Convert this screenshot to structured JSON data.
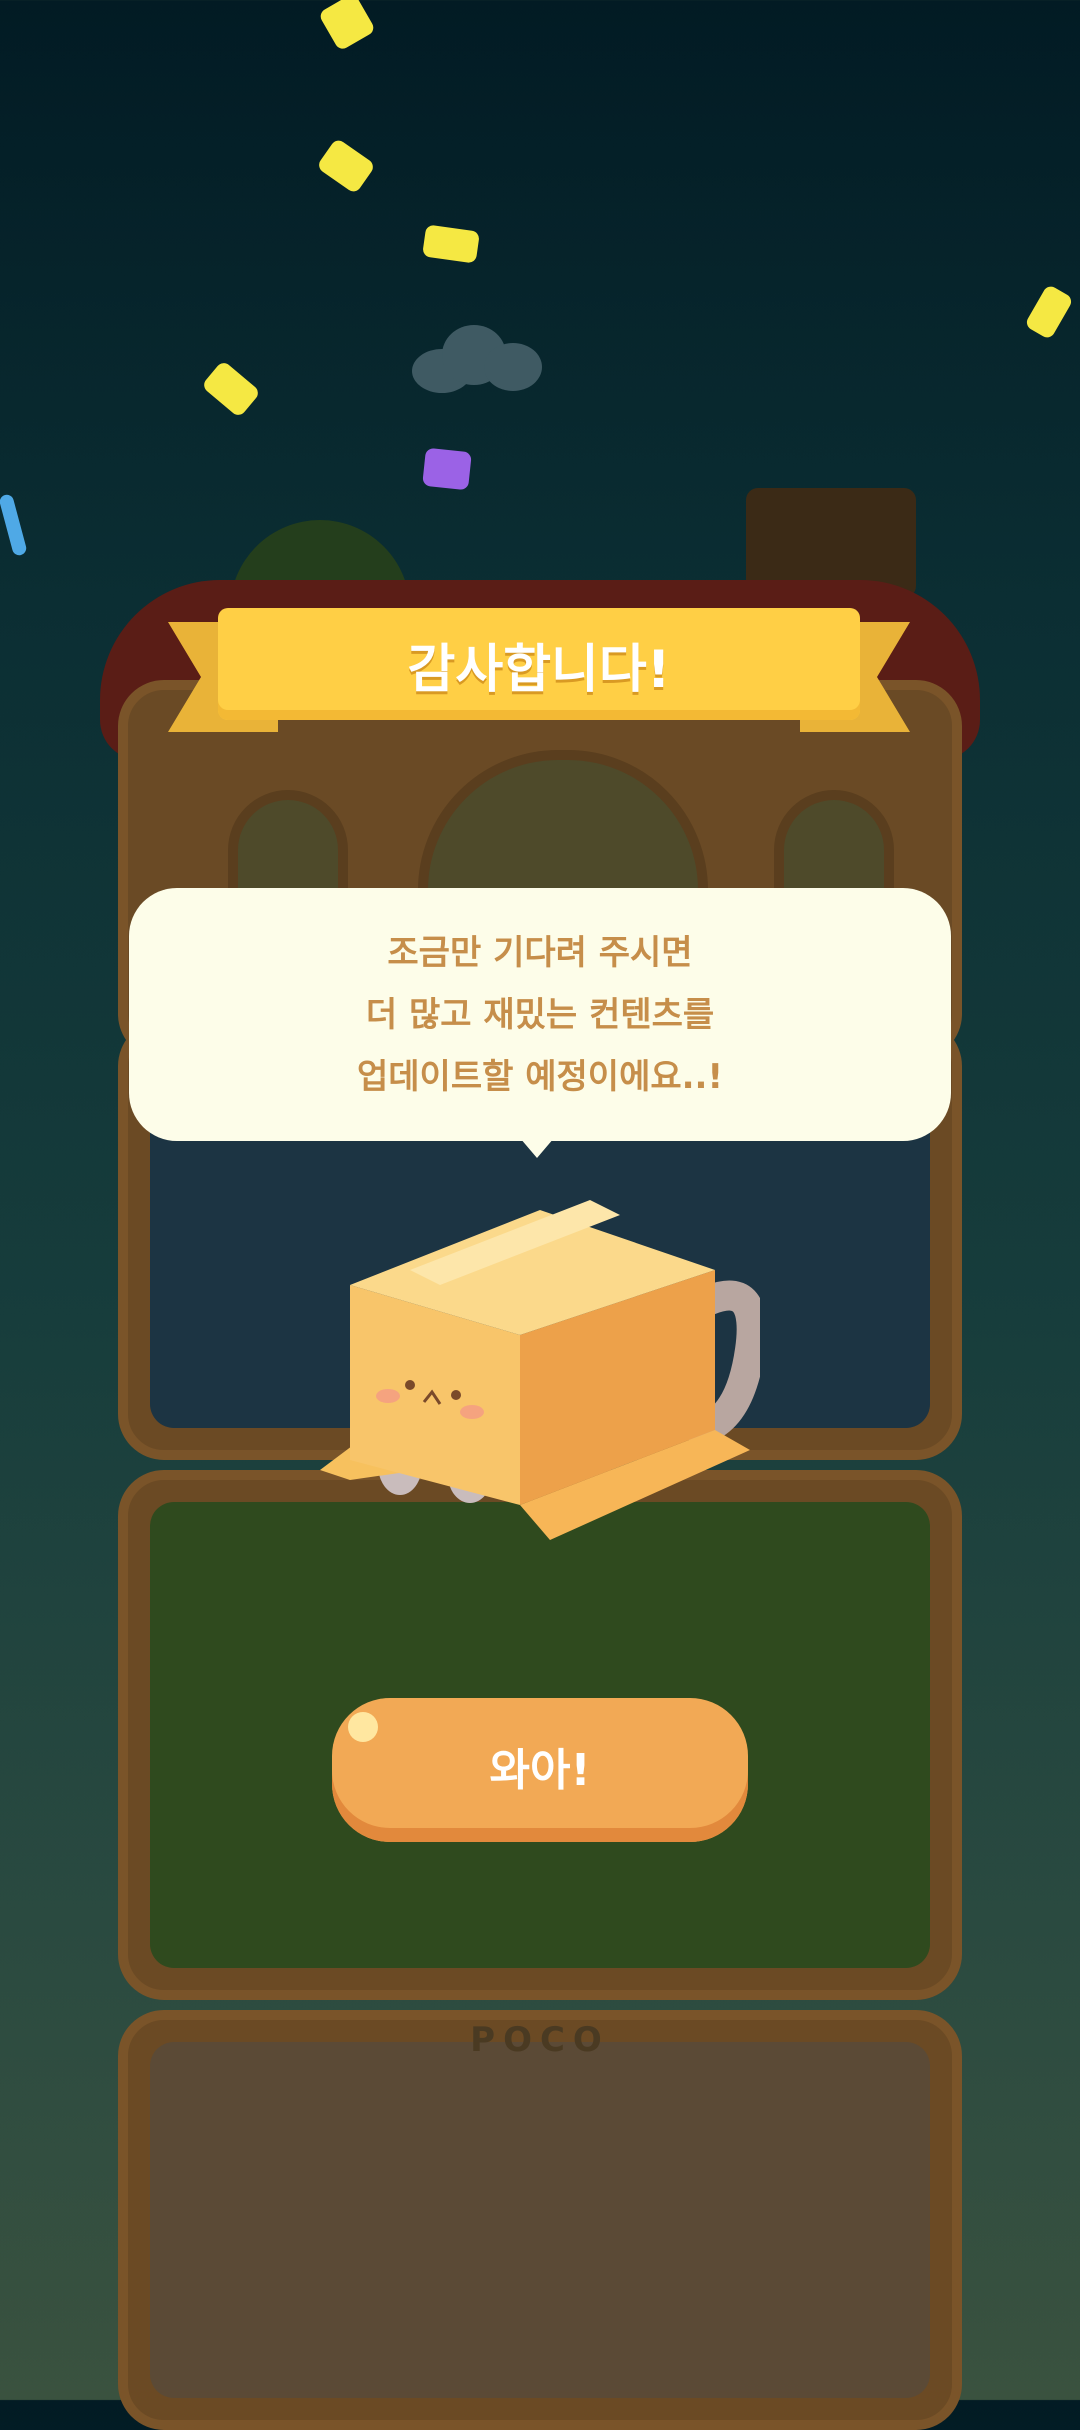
{
  "dialog": {
    "title": "감사합니다!",
    "message_lines": [
      "조금만 기다려 주시면",
      "더 많고 재밌는 컨텐츠를",
      "업데이트할 예정이에요..!"
    ],
    "confirm_label": "와아!"
  },
  "background": {
    "sign_text": "POCO"
  },
  "colors": {
    "ribbon": "#ffcf45",
    "bubble": "#fdfde9",
    "bubble_text": "#c68e4a",
    "button": "#f2a955",
    "confetti_yellow": "#f5e843",
    "confetti_purple": "#9b62e6",
    "confetti_blue": "#4fa9e6"
  }
}
